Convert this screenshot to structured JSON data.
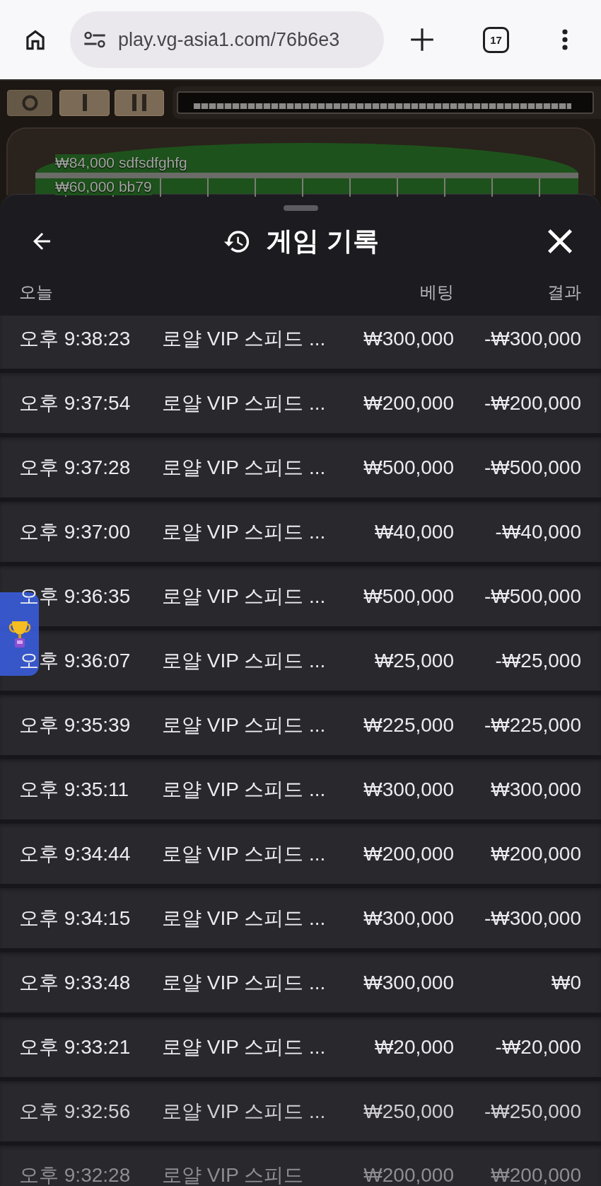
{
  "browser": {
    "url": "play.vg-asia1.com/76b6e3",
    "tab_count": "17"
  },
  "game": {
    "bets": [
      "₩84,000 sdfsdfghfg",
      "₩60,000 bb79"
    ]
  },
  "history": {
    "title": "게임 기록",
    "columns": {
      "date": "오늘",
      "bet": "베팅",
      "result": "결과"
    },
    "rows": [
      {
        "time": "오후 9:38:23",
        "game": "로얄 VIP 스피드 ...",
        "bet": "₩300,000",
        "result": "-₩300,000"
      },
      {
        "time": "오후 9:37:54",
        "game": "로얄 VIP 스피드 ...",
        "bet": "₩200,000",
        "result": "-₩200,000"
      },
      {
        "time": "오후 9:37:28",
        "game": "로얄 VIP 스피드 ...",
        "bet": "₩500,000",
        "result": "-₩500,000"
      },
      {
        "time": "오후 9:37:00",
        "game": "로얄 VIP 스피드 ...",
        "bet": "₩40,000",
        "result": "-₩40,000"
      },
      {
        "time": "오후 9:36:35",
        "game": "로얄 VIP 스피드 ...",
        "bet": "₩500,000",
        "result": "-₩500,000"
      },
      {
        "time": "오후 9:36:07",
        "game": "로얄 VIP 스피드 ...",
        "bet": "₩25,000",
        "result": "-₩25,000"
      },
      {
        "time": "오후 9:35:39",
        "game": "로얄 VIP 스피드 ...",
        "bet": "₩225,000",
        "result": "-₩225,000"
      },
      {
        "time": "오후 9:35:11",
        "game": "로얄 VIP 스피드 ...",
        "bet": "₩300,000",
        "result": "₩300,000"
      },
      {
        "time": "오후 9:34:44",
        "game": "로얄 VIP 스피드 ...",
        "bet": "₩200,000",
        "result": "₩200,000"
      },
      {
        "time": "오후 9:34:15",
        "game": "로얄 VIP 스피드 ...",
        "bet": "₩300,000",
        "result": "-₩300,000"
      },
      {
        "time": "오후 9:33:48",
        "game": "로얄 VIP 스피드 ...",
        "bet": "₩300,000",
        "result": "₩0"
      },
      {
        "time": "오후 9:33:21",
        "game": "로얄 VIP 스피드 ...",
        "bet": "₩20,000",
        "result": "-₩20,000"
      },
      {
        "time": "오후 9:32:56",
        "game": "로얄 VIP 스피드 ...",
        "bet": "₩250,000",
        "result": "-₩250,000"
      },
      {
        "time": "오후 9:32:28",
        "game": "로얄 VIP 스피드",
        "bet": "₩200,000",
        "result": "₩200,000"
      }
    ]
  }
}
